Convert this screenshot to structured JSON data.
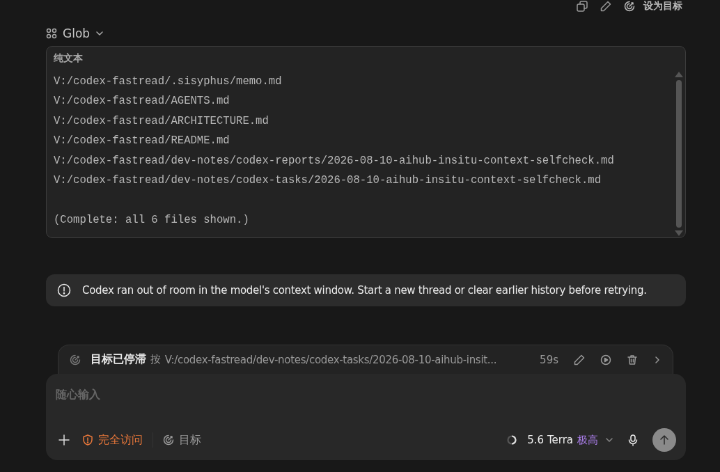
{
  "top_actions": {
    "set_goal": "设为目标"
  },
  "tool_call": {
    "name": "Glob",
    "expanded": true,
    "output_label": "纯文本",
    "lines": [
      "V:/codex-fastread/.sisyphus/memo.md",
      "V:/codex-fastread/AGENTS.md",
      "V:/codex-fastread/ARCHITECTURE.md",
      "V:/codex-fastread/README.md",
      "V:/codex-fastread/dev-notes/codex-reports/2026-08-10-aihub-insitu-context-selfcheck.md",
      "V:/codex-fastread/dev-notes/codex-tasks/2026-08-10-aihub-insitu-context-selfcheck.md"
    ],
    "summary": "(Complete: all 6 files shown.)"
  },
  "error": {
    "message": "Codex ran out of room in the model's context window. Start a new thread or clear earlier history before retrying."
  },
  "goal_bar": {
    "status": "目标已停滞",
    "prefix": "按",
    "text": "V:/codex-fastread/dev-notes/codex-tasks/2026-08-10-aihub-insit...",
    "elapsed": "59s"
  },
  "composer": {
    "placeholder": "随心输入",
    "access": "完全访问",
    "goal": "目标",
    "model": "5.6 Terra",
    "effort": "极高"
  }
}
